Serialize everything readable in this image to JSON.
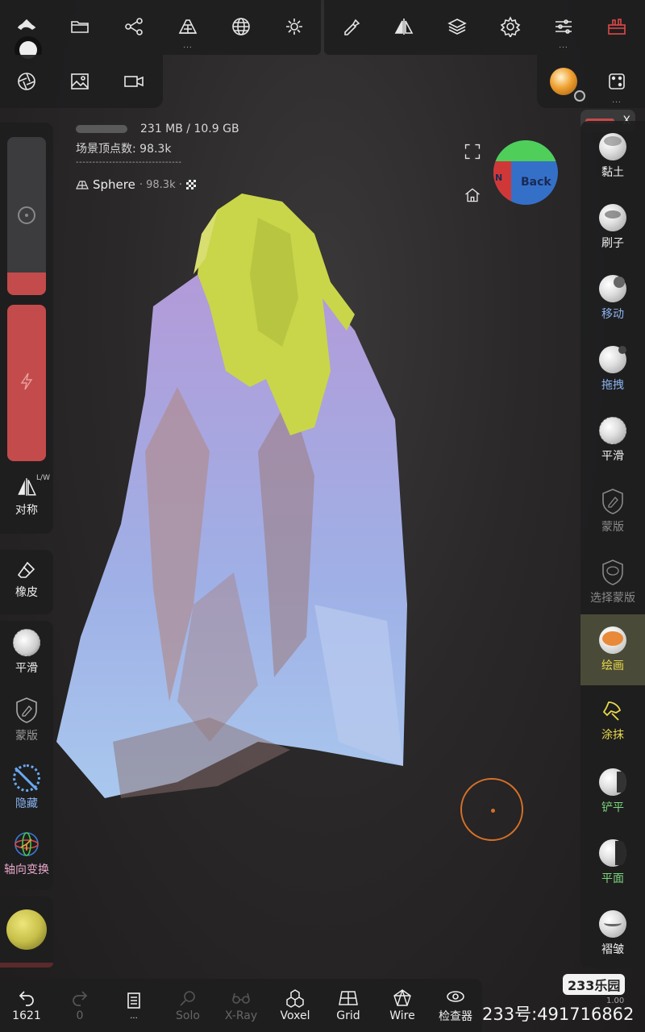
{
  "colors": {
    "accent_red": "#c44b4b",
    "active_bg": "#4a4a38",
    "paint_orange": "#e88a3a"
  },
  "top_toolbar": {
    "row1_left": [
      {
        "icon": "bucket-icon"
      },
      {
        "icon": "folder-icon"
      },
      {
        "icon": "scene-graph-icon"
      },
      {
        "icon": "topology-icon",
        "dots": "..."
      },
      {
        "icon": "sphere-mesh-icon"
      },
      {
        "icon": "sun-icon"
      }
    ],
    "row2_left": [
      {
        "icon": "aperture-icon"
      },
      {
        "icon": "image-icon"
      },
      {
        "icon": "video-camera-icon"
      }
    ],
    "row1_right": [
      {
        "icon": "pen-tool-icon"
      },
      {
        "icon": "symmetry-icon"
      },
      {
        "icon": "layers-icon"
      },
      {
        "icon": "gear-icon"
      },
      {
        "icon": "sliders-icon",
        "dots": "..."
      },
      {
        "icon": "toolbox-icon"
      }
    ],
    "row2_right": [
      {
        "icon": "material-ball-icon"
      },
      {
        "icon": "dice-icon",
        "dots": "..."
      }
    ]
  },
  "info": {
    "memory": "231 MB / 10.9 GB",
    "vertices": "场景顶点数: 98.3k",
    "separator": "--------------------------------",
    "mesh_name": "Sphere",
    "mesh_count": "· 98.3k ·"
  },
  "gizmo": {
    "face_label": "Back",
    "side_label": "N"
  },
  "left_panel": {
    "symmetry": {
      "label": "对称",
      "badge": "L/W"
    },
    "eraser": {
      "label": "橡皮"
    },
    "tools": [
      {
        "label": "平滑",
        "icon": "smooth-icon"
      },
      {
        "label": "蒙版",
        "icon": "mask-icon"
      },
      {
        "label": "隐藏",
        "icon": "hide-icon"
      },
      {
        "label": "轴向变换",
        "icon": "gizmo-transform-icon"
      }
    ]
  },
  "right_panel": {
    "closebar": {
      "label": "X"
    },
    "tools": [
      {
        "label": "黏土",
        "style": "normal"
      },
      {
        "label": "刷子",
        "style": "normal"
      },
      {
        "label": "移动",
        "style": "blue"
      },
      {
        "label": "拖拽",
        "style": "blue"
      },
      {
        "label": "平滑",
        "style": "normal"
      },
      {
        "label": "蒙版",
        "style": "dim"
      },
      {
        "label": "选择蒙版",
        "style": "dim"
      },
      {
        "label": "绘画",
        "style": "yellow"
      },
      {
        "label": "涂抹",
        "style": "yellow"
      },
      {
        "label": "铲平",
        "style": "green"
      },
      {
        "label": "平面",
        "style": "green"
      },
      {
        "label": "褶皱",
        "style": "normal"
      }
    ]
  },
  "bottom_bar": [
    {
      "label": "1621",
      "icon": "undo-icon",
      "dim": false
    },
    {
      "label": "0",
      "icon": "redo-icon",
      "dim": true
    },
    {
      "label": "...",
      "icon": "book-icon",
      "dim": false
    },
    {
      "label": "Solo",
      "icon": "solo-icon",
      "dim": true
    },
    {
      "label": "X-Ray",
      "icon": "xray-icon",
      "dim": true
    },
    {
      "label": "Voxel",
      "icon": "voxel-icon",
      "dim": false
    },
    {
      "label": "Grid",
      "icon": "grid-icon",
      "dim": false
    },
    {
      "label": "Wire",
      "icon": "wire-icon",
      "dim": false
    },
    {
      "label": "检查器",
      "icon": "inspector-icon",
      "dim": false
    }
  ],
  "watermark": {
    "logo": "233乐园",
    "text": "233号:491716862",
    "zoom": "1.00"
  }
}
